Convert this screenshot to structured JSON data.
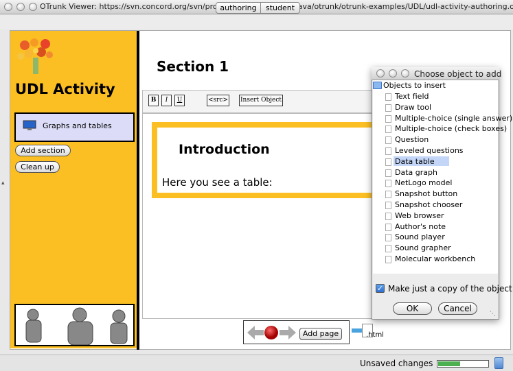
{
  "window": {
    "title": "OTrunk Viewer: https://svn.concord.org/svn/projects/trunk/common/java/otrunk/otrunk-examples/UDL/udl-activity-authoring.otml"
  },
  "mode_tabs": [
    "authoring",
    "student"
  ],
  "sidebar": {
    "activity_title": "UDL Activity",
    "nav_item": "Graphs and tables",
    "add_section": "Add section",
    "clean_up": "Clean up"
  },
  "content": {
    "section_title": "Section 1",
    "toolbar": {
      "bold": "B",
      "italic": "I",
      "underline": "U",
      "src": "<src>",
      "insert_object": "Insert Object"
    },
    "intro_title": "Introduction",
    "intro_text": "Here you see a table:"
  },
  "bottom_nav": {
    "add_page": "Add page",
    "html_label": ".html"
  },
  "status": {
    "unsaved": "Unsaved changes",
    "progress": 0.45
  },
  "dialog": {
    "title": "Choose object to add",
    "root": "Objects to insert",
    "items": [
      "Text field",
      "Draw tool",
      "Multiple-choice (single answer)",
      "Multiple-choice (check boxes)",
      "Question",
      "Leveled questions",
      "Data table",
      "Data graph",
      "NetLogo model",
      "Snapshot button",
      "Snapshot chooser",
      "Web browser",
      "Author's note",
      "Sound player",
      "Sound grapher",
      "Molecular workbench"
    ],
    "selected_index": 6,
    "copy_checkbox": "Make just a copy of the object",
    "ok": "OK",
    "cancel": "Cancel"
  }
}
